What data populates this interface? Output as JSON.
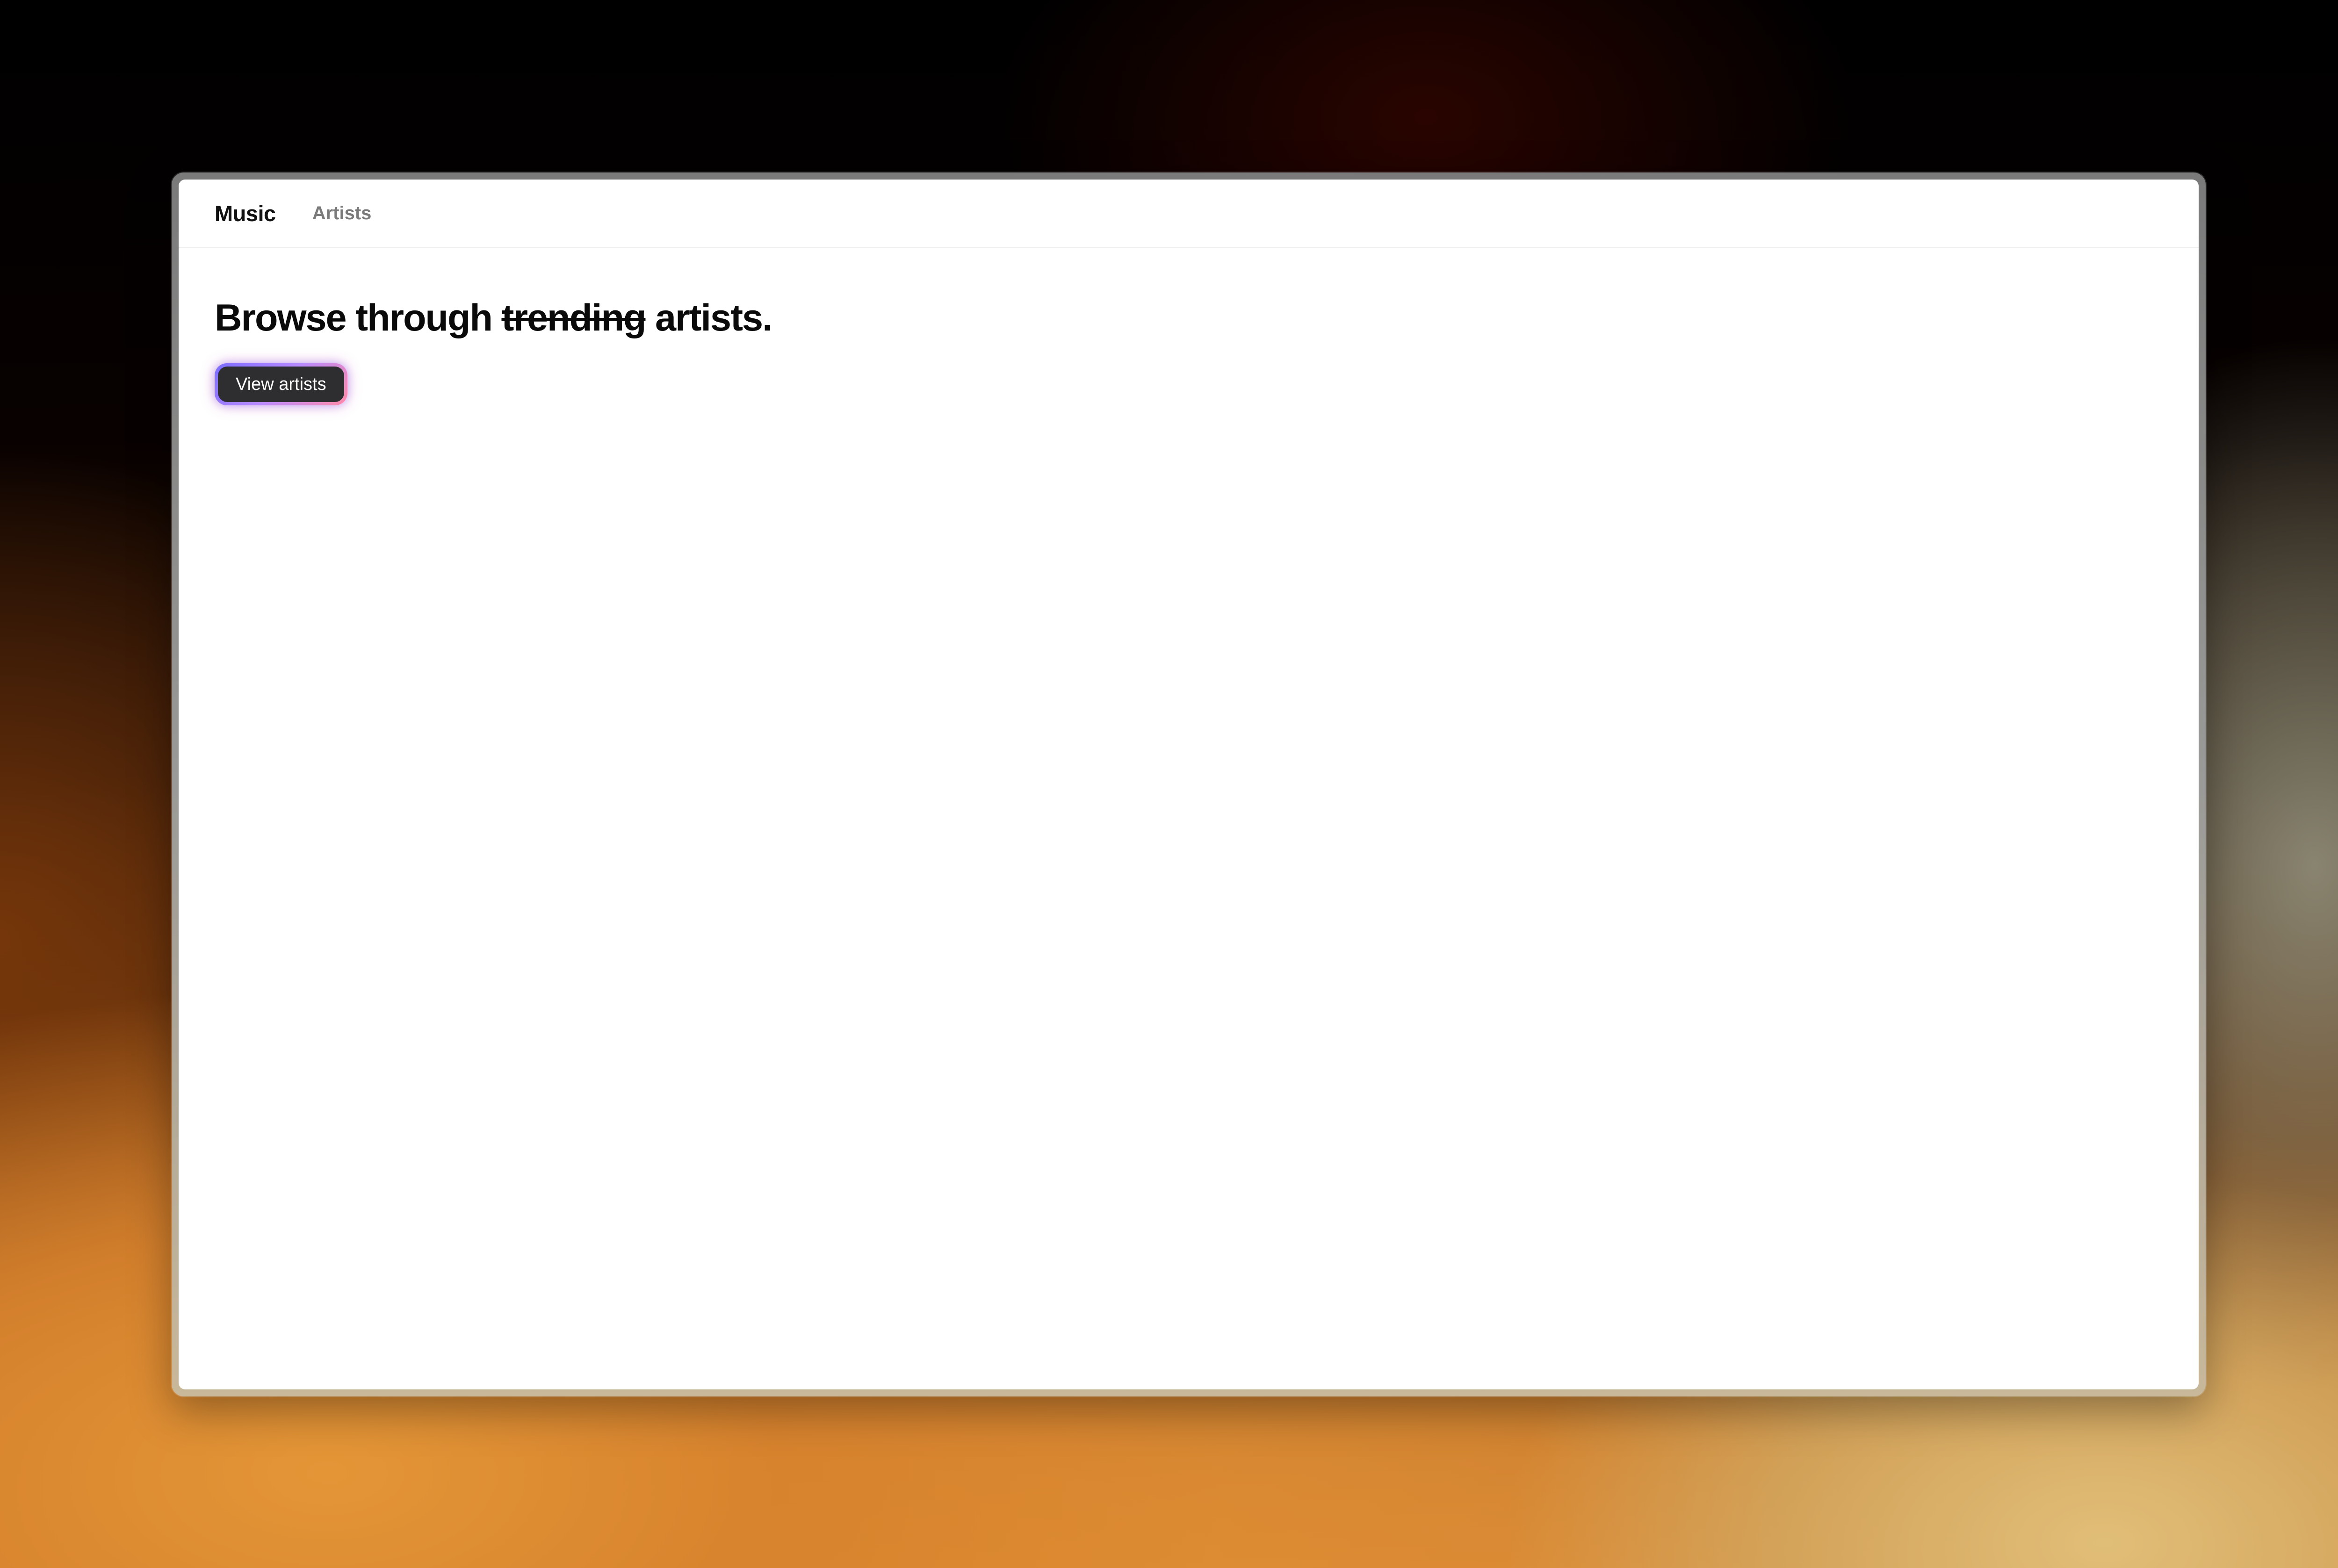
{
  "nav": {
    "brand": "Music",
    "links": [
      {
        "label": "Artists"
      }
    ]
  },
  "hero": {
    "headline_start": "Browse through ",
    "headline_strikethrough": "trending",
    "headline_end": " artists.",
    "cta_label": "View artists"
  },
  "colors": {
    "button_background": "#2e2e30",
    "button_glow_start": "#7a6cff",
    "button_glow_end": "#ff8aa8",
    "nav_link": "#7a7a7a"
  }
}
